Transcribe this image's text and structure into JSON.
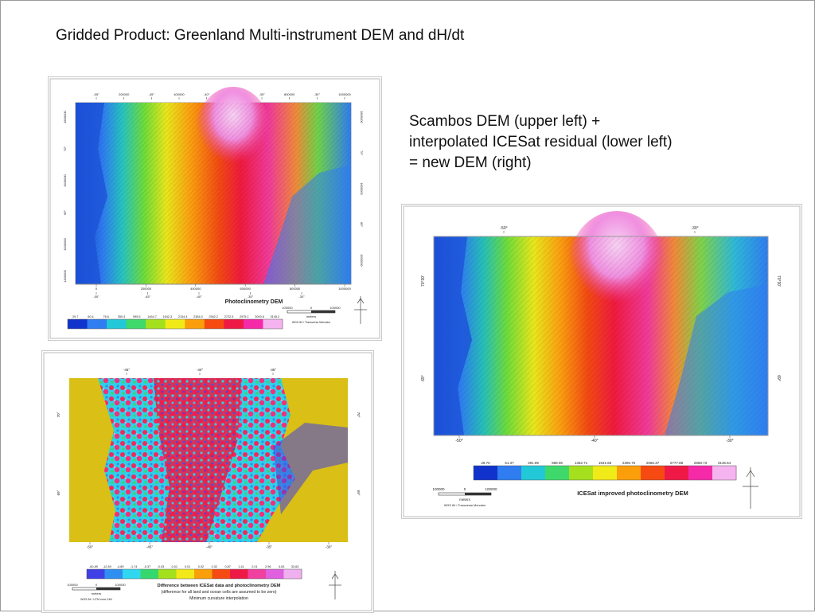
{
  "slide": {
    "title": "Gridded Product:  Greenland Multi-instrument DEM and dH/dt",
    "caption": [
      "Scambos DEM (upper left) +",
      "interpolated ICESat residual (lower left)",
      "= new DEM (right)"
    ]
  },
  "panel_upper_left": {
    "name": "Photoclinometry DEM",
    "top_ticks": [
      "-55°",
      "200000",
      "-45°",
      "400000",
      "-40°",
      "600000",
      "-35°",
      "800000",
      "-30°",
      "1000000"
    ],
    "bottom_ticks": [
      "0",
      "200000",
      "400000",
      "600000",
      "800000",
      "1000000"
    ],
    "bottom_deg_ticks": [
      "-50°",
      "-45°",
      "-40°",
      "-35°",
      "-30°"
    ],
    "left_ticks": [
      "1800000",
      "70°",
      "1600000",
      "69°",
      "1500000",
      "1400000"
    ],
    "right_ticks": [
      "1800000",
      "70°",
      "1600000",
      "69°",
      "1500000"
    ],
    "legend_values": [
      "29.7",
      "60.4",
      "76.6",
      "350.4",
      "995.5",
      "1464.7",
      "1642.3",
      "2134.4",
      "2384.0",
      "2562.2",
      "2722.5",
      "2975.1",
      "3000.6",
      "3145.2"
    ],
    "scale": [
      "100000",
      "0",
      "100000"
    ],
    "scale_unit": "meters",
    "projection": "WGS 84 / Transverse Mercator"
  },
  "panel_lower_left": {
    "name": "Difference between ICESat data and photoclinometry DEM",
    "subtitle": "(difference for all land and ocean cells are assumed to be zero)",
    "method": "Minimum curvature interpolation",
    "top_ticks": [
      "-45°",
      "-40°",
      "-35°"
    ],
    "bottom_ticks": [
      "-50°",
      "-45°",
      "-40°",
      "-35°",
      "-30°"
    ],
    "left_ticks": [
      "70°",
      "69°"
    ],
    "right_ticks": [
      "70°",
      "69°"
    ],
    "legend_values": [
      "-60.89",
      "-12.69",
      "-4.89",
      "-1.74",
      "-0.37",
      "-0.03",
      "-0.01",
      "0.01",
      "0.02",
      "0.32",
      "0.87",
      "1.41",
      "2.01",
      "2.96",
      "4.63",
      "33.63"
    ],
    "scale": [
      "100000",
      "0",
      "100000"
    ],
    "scale_unit": "meters",
    "projection": "WGS 84 / UTM zone 24N"
  },
  "panel_right": {
    "name": "ICESat improved photoclinometry DEM",
    "top_ticks": [
      "-50°",
      "-40°",
      "-30°"
    ],
    "bottom_ticks": [
      "-50°",
      "-40°",
      "-30°"
    ],
    "left_ticks": [
      "70°30'",
      "69°"
    ],
    "right_ticks": [
      "70°30'",
      "69°"
    ],
    "legend_values": [
      "29.70",
      "61.37",
      "391.99",
      "989.06",
      "1462.71",
      "1941.68",
      "2305.76",
      "2566.37",
      "2777.88",
      "2958.73",
      "3145.54"
    ],
    "scale": [
      "100000",
      "0",
      "100000"
    ],
    "scale_unit": "meters",
    "projection": "WGS 84 / Transverse Mercator"
  },
  "colors": {
    "dem_ramp": [
      "#1133cc",
      "#2f7df0",
      "#23c8d8",
      "#3fd96b",
      "#a4e01e",
      "#f1ea19",
      "#fa9f0b",
      "#f54a12",
      "#ee1a45",
      "#f52aa8",
      "#f5b3ef"
    ],
    "diff_ramp": [
      "#3f3fe6",
      "#2f8ff0",
      "#2fd8f0",
      "#36d86e",
      "#a4e01e",
      "#f2e81a",
      "#fa9f0b",
      "#f54a12",
      "#ee1a45",
      "#f040a0",
      "#e060e0",
      "#f0b0f0"
    ],
    "land": "#d9bf16"
  }
}
